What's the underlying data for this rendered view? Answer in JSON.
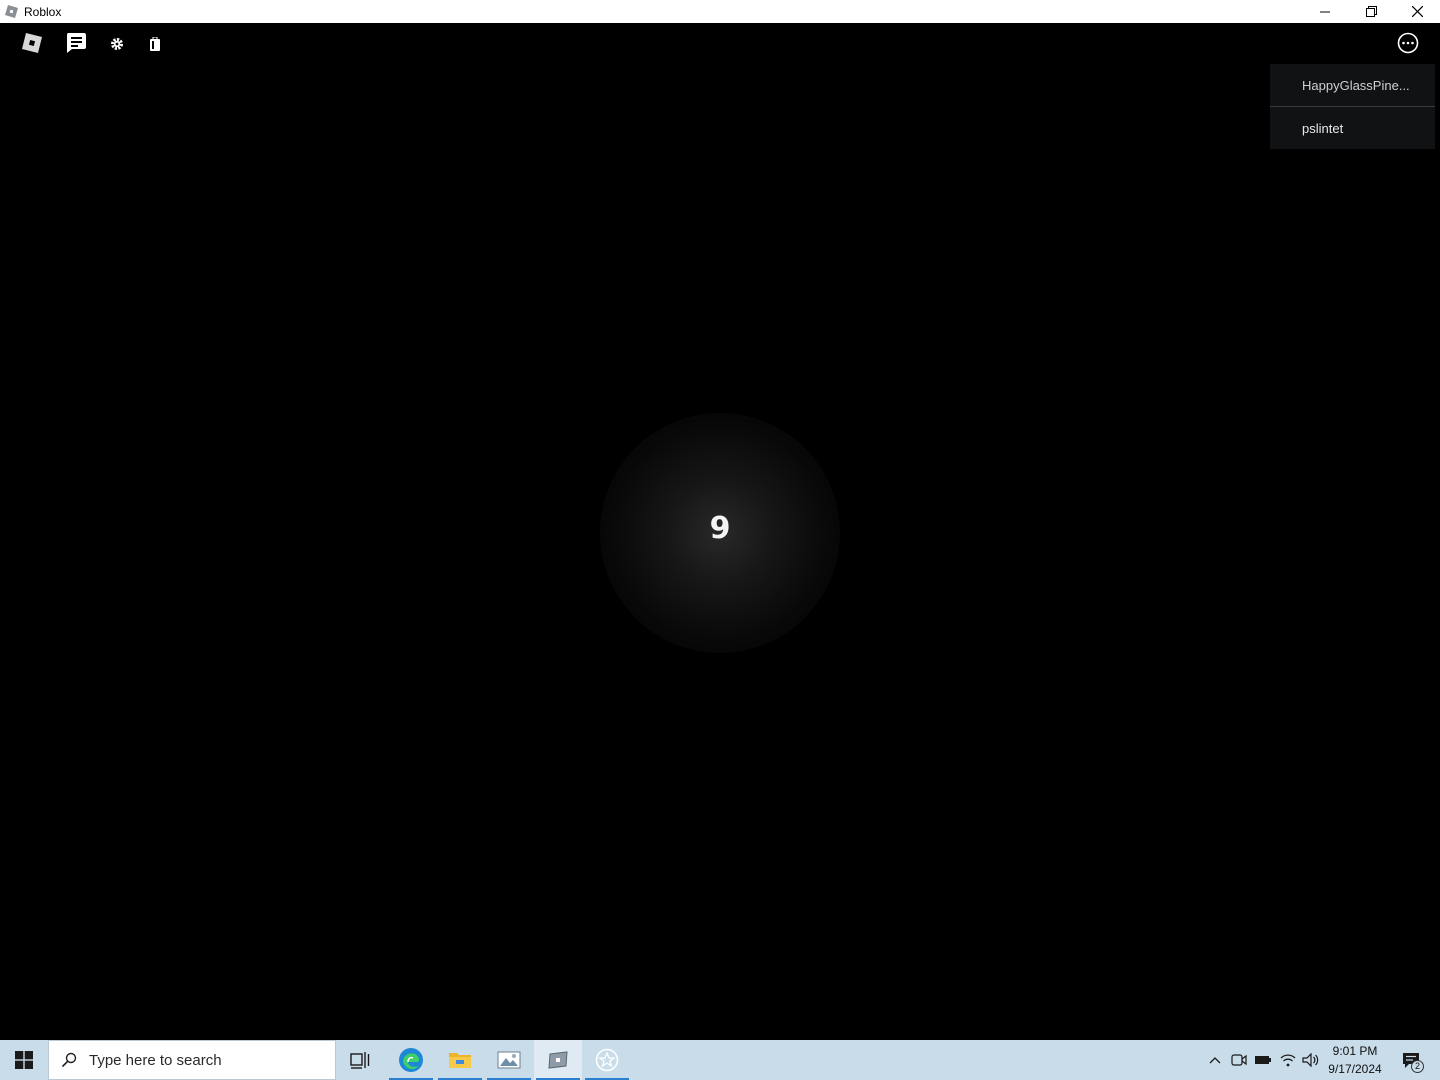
{
  "window": {
    "title": "Roblox",
    "app_icon": "roblox-icon",
    "controls": [
      "minimize-icon",
      "restore-icon",
      "close-icon"
    ]
  },
  "game": {
    "topbar_icons": [
      "roblox-menu-icon",
      "chat-icon",
      "settings-icon",
      "backpack-icon"
    ],
    "more_icon": "more-options-icon",
    "countdown": "9",
    "player_list": [
      "HappyGlassPine...",
      "pslintet"
    ]
  },
  "taskbar": {
    "search_placeholder": "Type here to search",
    "apps": [
      "task-view-icon",
      "edge-icon",
      "file-explorer-icon",
      "photos-icon",
      "roblox-icon",
      "roblox-studio-icon"
    ],
    "tray_icons": [
      "chevron-up-icon",
      "meet-icon",
      "battery-icon",
      "wifi-icon",
      "volume-icon"
    ],
    "time": "9:01 PM",
    "date": "9/17/2024",
    "notification_count": "2",
    "accent": "#2b7fd0",
    "background": "#c9dce9"
  }
}
